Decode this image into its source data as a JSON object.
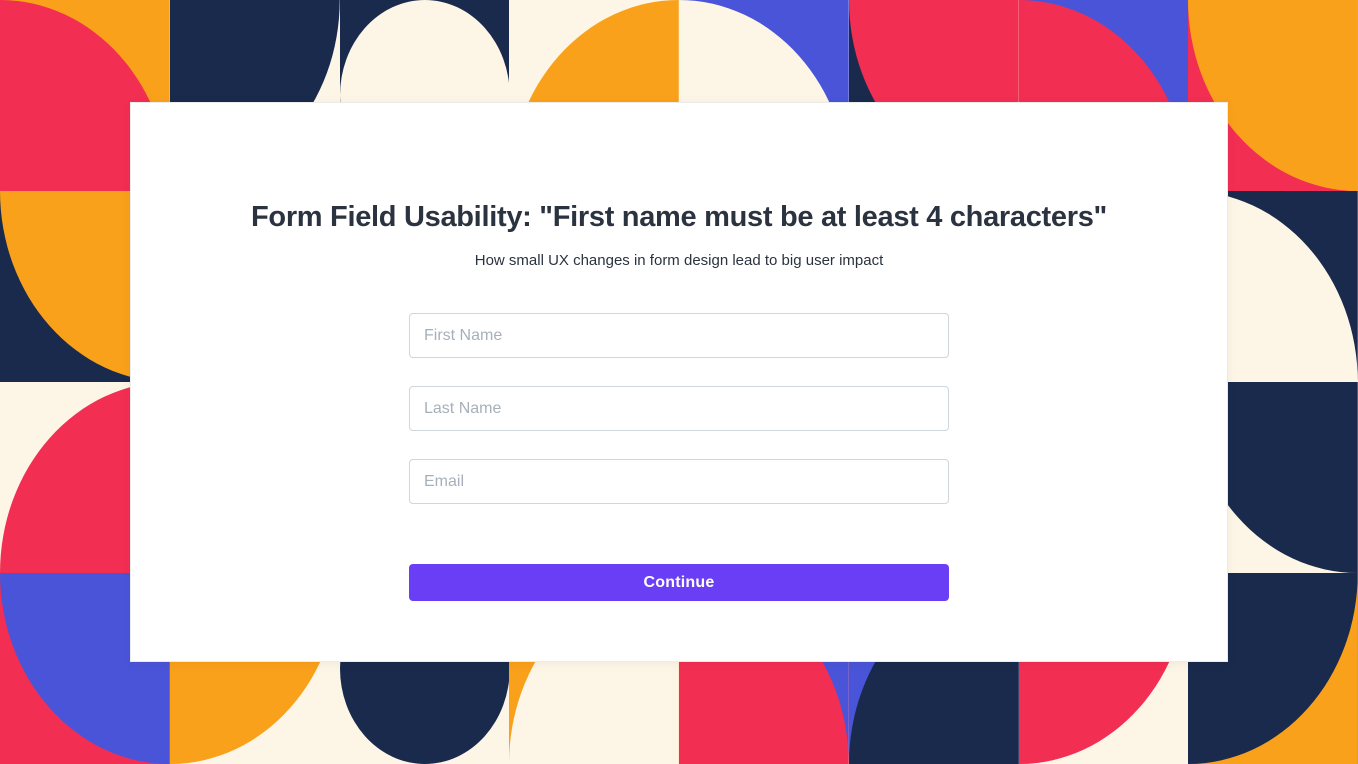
{
  "header": {
    "title": "Form Field Usability: \"First name must be at least 4 characters\"",
    "subtitle": "How small UX changes in form design lead to big user impact"
  },
  "form": {
    "first_name": {
      "placeholder": "First Name",
      "value": ""
    },
    "last_name": {
      "placeholder": "Last Name",
      "value": ""
    },
    "email": {
      "placeholder": "Email",
      "value": ""
    }
  },
  "actions": {
    "continue_label": "Continue"
  },
  "colors": {
    "accent": "#6a3ef5",
    "text": "#2b3340",
    "border": "#cfd6dd",
    "placeholder": "#a7b0ba",
    "bg_cream": "#fdf5e6",
    "bg_navy": "#192a4d",
    "bg_red": "#f22e52",
    "bg_orange": "#f9a11b",
    "bg_blue": "#4a54d8"
  }
}
